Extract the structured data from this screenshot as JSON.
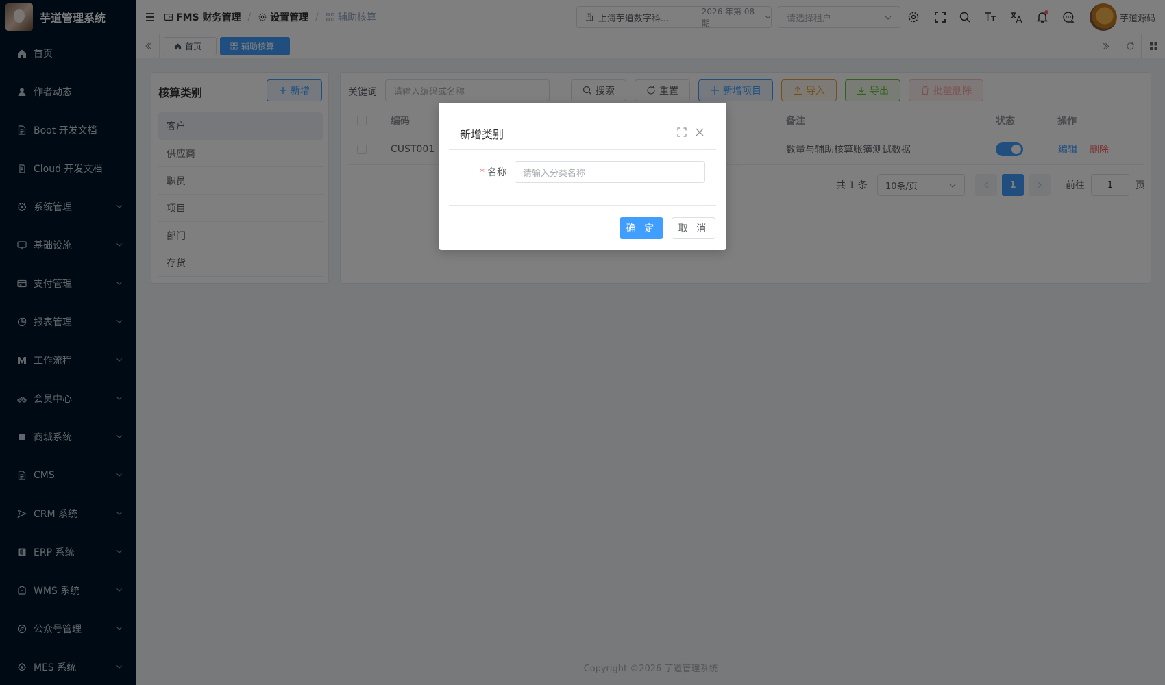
{
  "app": {
    "title": "芋道管理系统"
  },
  "sidebar": {
    "items": [
      {
        "label": "首页",
        "icon": "home-icon"
      },
      {
        "label": "作者动态",
        "icon": "user-icon"
      },
      {
        "label": "Boot 开发文档",
        "icon": "document-icon"
      },
      {
        "label": "Cloud 开发文档",
        "icon": "document-copy-icon"
      },
      {
        "label": "系统管理",
        "icon": "gear-icon"
      },
      {
        "label": "基础设施",
        "icon": "monitor-icon"
      },
      {
        "label": "支付管理",
        "icon": "payment-icon"
      },
      {
        "label": "报表管理",
        "icon": "pie-chart-icon"
      },
      {
        "label": "工作流程",
        "icon": "workflow-icon"
      },
      {
        "label": "会员中心",
        "icon": "bicycle-icon"
      },
      {
        "label": "商城系统",
        "icon": "shop-icon"
      },
      {
        "label": "CMS",
        "icon": "document-icon"
      },
      {
        "label": "CRM 系统",
        "icon": "send-icon"
      },
      {
        "label": "ERP 系统",
        "icon": "erp-icon"
      },
      {
        "label": "WMS 系统",
        "icon": "box-icon"
      },
      {
        "label": "公众号管理",
        "icon": "compass-icon"
      },
      {
        "label": "MES 系统",
        "icon": "cpu-icon"
      }
    ]
  },
  "header": {
    "breadcrumb": [
      "FMS 财务管理",
      "设置管理",
      "辅助核算"
    ],
    "company": "上海芋道数字科...",
    "period": "2026 年第 08 期",
    "tenant_placeholder": "请选择租户",
    "user_name": "芋道源码"
  },
  "tags": {
    "home": "首页",
    "current": "辅助核算"
  },
  "left_panel": {
    "title": "核算类别",
    "add_label": "新增",
    "categories": [
      "客户",
      "供应商",
      "职员",
      "项目",
      "部门",
      "存货"
    ],
    "active_index": 0
  },
  "toolbar": {
    "keyword_label": "关键词",
    "keyword_placeholder": "请输入编码或名称",
    "search": "搜索",
    "reset": "重置",
    "add_item": "新增项目",
    "import": "导入",
    "export": "导出",
    "batch_delete": "批量删除"
  },
  "table": {
    "columns": {
      "code": "编码",
      "remark": "备注",
      "status": "状态",
      "action": "操作"
    },
    "rows": [
      {
        "code": "CUST001",
        "remark": "数量与辅助核算账簿测试数据",
        "status": true,
        "edit": "编辑",
        "delete": "删除"
      }
    ]
  },
  "pagination": {
    "total": "共 1 条",
    "page_size": "10条/页",
    "current_page": "1",
    "goto_prefix": "前往",
    "goto_value": "1",
    "goto_suffix": "页"
  },
  "footer": {
    "copyright": "Copyright ©2026 芋道管理系统"
  },
  "dialog": {
    "title": "新增类别",
    "name_label": "名称",
    "name_placeholder": "请输入分类名称",
    "confirm": "确 定",
    "cancel": "取 消"
  },
  "colors": {
    "primary": "#409eff",
    "sidebar_bg": "#001529",
    "danger": "#f56c6c",
    "warning": "#e6a23c",
    "success": "#67c23a"
  }
}
